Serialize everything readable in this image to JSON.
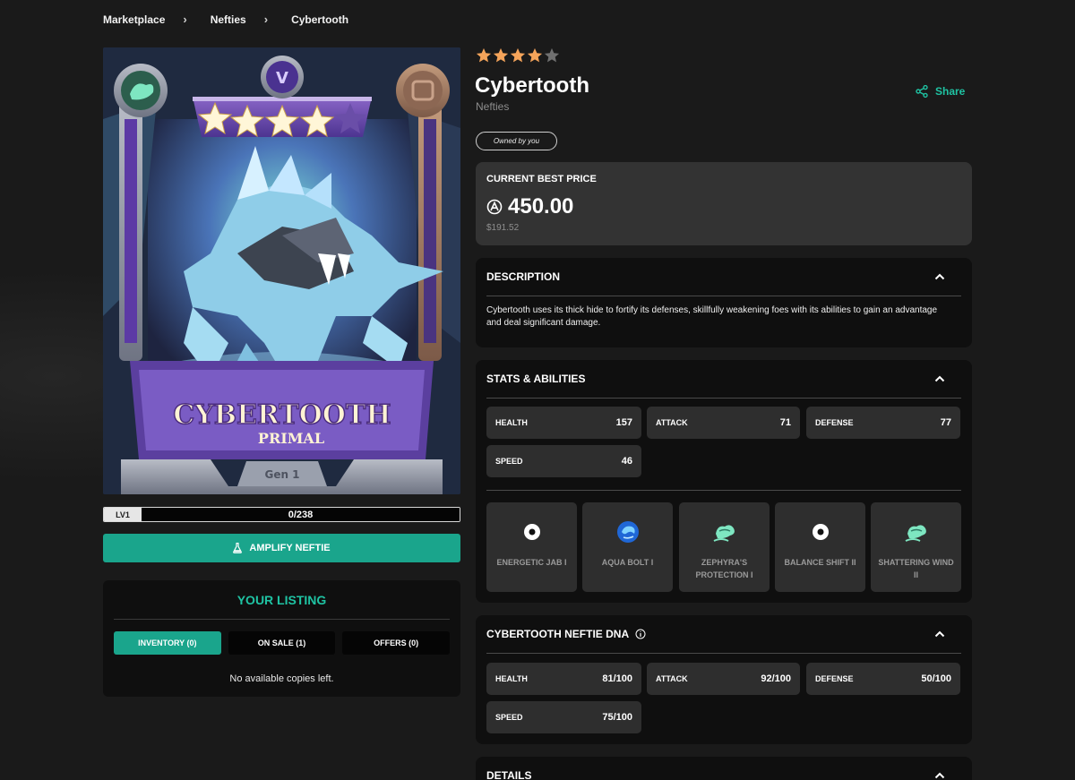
{
  "breadcrumb": [
    "Marketplace",
    "Nefties",
    "Cybertooth"
  ],
  "card": {
    "name": "CYBERTOOTH",
    "class": "PRIMAL",
    "generation": "Gen 1",
    "stars": 4
  },
  "level": {
    "label": "LV1",
    "progress_text": "0/238",
    "progress_fraction": 0.0
  },
  "amplify_button": "AMPLIFY NEFTIE",
  "listing": {
    "title": "YOUR LISTING",
    "tabs": [
      {
        "label": "INVENTORY (0)",
        "active": true
      },
      {
        "label": "ON SALE (1)",
        "active": false
      },
      {
        "label": "OFFERS (0)",
        "active": false
      }
    ],
    "empty_text": "No available copies left."
  },
  "rating": {
    "value": 4,
    "max": 5
  },
  "header": {
    "title": "Cybertooth",
    "subtitle": "Nefties",
    "share_label": "Share",
    "owned_badge": "Owned by you"
  },
  "price": {
    "label": "CURRENT BEST PRICE",
    "value": "450.00",
    "usd": "$191.52"
  },
  "description": {
    "title": "DESCRIPTION",
    "text": "Cybertooth uses its thick hide to fortify its defenses, skillfully weakening foes with its abilities to gain an advantage and deal significant damage."
  },
  "stats": {
    "title": "STATS & ABILITIES",
    "items": [
      {
        "label": "HEALTH",
        "value": "157"
      },
      {
        "label": "ATTACK",
        "value": "71"
      },
      {
        "label": "DEFENSE",
        "value": "77"
      },
      {
        "label": "SPEED",
        "value": "46"
      }
    ],
    "abilities": [
      {
        "name": "ENERGETIC JAB I",
        "icon": "dot-icon"
      },
      {
        "name": "AQUA BOLT I",
        "icon": "water-icon"
      },
      {
        "name": "ZEPHYRA'S PROTECTION I",
        "icon": "wind-icon"
      },
      {
        "name": "BALANCE SHIFT II",
        "icon": "dot-icon"
      },
      {
        "name": "SHATTERING WIND II",
        "icon": "wind-icon"
      }
    ]
  },
  "dna": {
    "title": "CYBERTOOTH NEFTIE DNA",
    "items": [
      {
        "label": "HEALTH",
        "value": "81/100"
      },
      {
        "label": "ATTACK",
        "value": "92/100"
      },
      {
        "label": "DEFENSE",
        "value": "50/100"
      },
      {
        "label": "SPEED",
        "value": "75/100"
      }
    ]
  },
  "details": {
    "title": "DETAILS"
  },
  "colors": {
    "accent": "#1aa58c",
    "accent_text": "#1fc3a3",
    "star": "#f5a45a",
    "panel": "#0f0f0f",
    "panel_light": "#333333"
  }
}
